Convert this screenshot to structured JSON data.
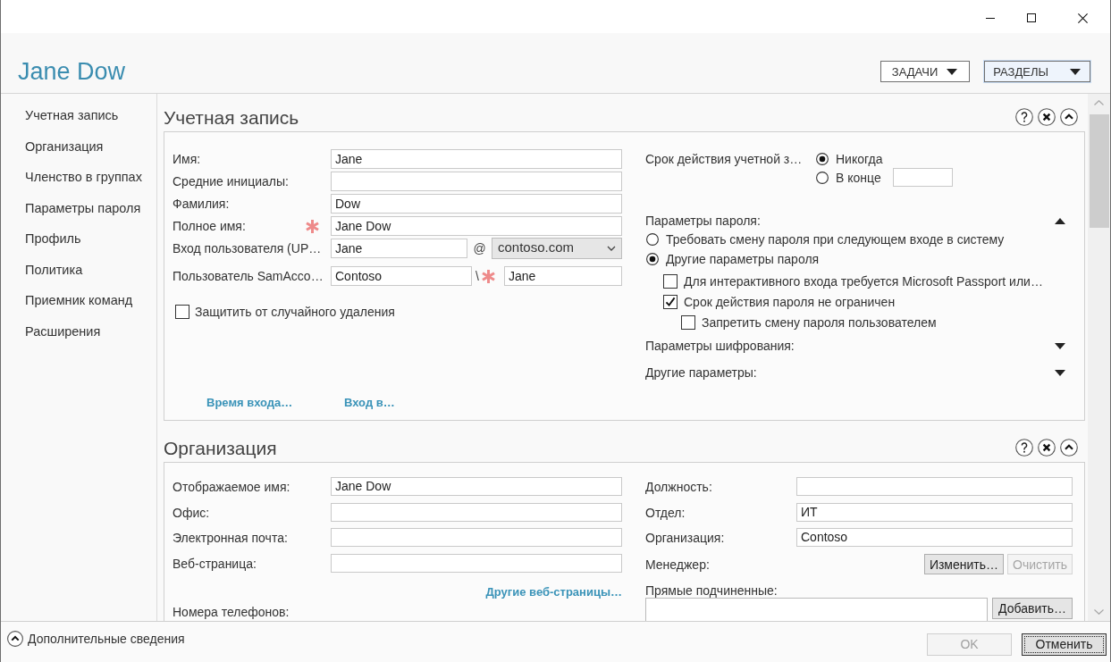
{
  "header": {
    "title": "Jane Dow",
    "menus": [
      {
        "label": "ЗАДАЧИ",
        "highlighted": false
      },
      {
        "label": "РАЗДЕЛЫ",
        "highlighted": true
      }
    ]
  },
  "sidebar": {
    "items": [
      {
        "label": "Учетная запись"
      },
      {
        "label": "Организация"
      },
      {
        "label": "Членство в группах"
      },
      {
        "label": "Параметры пароля"
      },
      {
        "label": "Профиль"
      },
      {
        "label": "Политика"
      },
      {
        "label": "Приемник команд"
      },
      {
        "label": "Расширения"
      }
    ]
  },
  "account": {
    "title": "Учетная запись",
    "fields": [
      {
        "kind": "text",
        "label": "Имя:",
        "value": "Jane",
        "required": false
      },
      {
        "kind": "text",
        "label": "Средние инициалы:",
        "required": false
      },
      {
        "kind": "text",
        "label": "Фамилия:",
        "value": "Dow",
        "required": false
      },
      {
        "kind": "text",
        "label": "Полное имя:",
        "value": "Jane Dow",
        "required": true
      },
      {
        "kind": "upn",
        "label": "Вход пользователя (UP…",
        "value": "Jane",
        "separator": "@",
        "domain": "contoso.com",
        "required": false
      },
      {
        "kind": "sam",
        "label": "Пользователь SamAcco…",
        "value": "Contoso",
        "separator": "\\",
        "value_2": "Jane",
        "required": true
      }
    ],
    "protect": {
      "label": "Защитить от случайного удаления",
      "checked": false
    },
    "links": [
      "Время входа…",
      "Вход в…"
    ],
    "expiry": {
      "label": "Срок действия учетной з…",
      "options": [
        {
          "kind": "plain",
          "label": "Никогда",
          "selected": true
        },
        {
          "kind": "date",
          "label": "В конце",
          "selected": false
        }
      ]
    },
    "password": {
      "label": "Параметры пароля:",
      "expanded": true,
      "options": [
        {
          "label": "Требовать смену пароля при следующем входе в систему",
          "selected": false
        },
        {
          "label": "Другие параметры пароля",
          "selected": true
        }
      ],
      "checkboxes": [
        {
          "label": "Для интерактивного входа требуется Microsoft Passport или…",
          "checked": false
        },
        {
          "label": "Срок действия пароля не ограничен",
          "checked": true,
          "children": [
            {
              "label": "Запретить смену пароля пользователем",
              "checked": false
            }
          ]
        }
      ]
    },
    "groups": [
      {
        "label": "Параметры шифрования:",
        "expanded": false
      },
      {
        "label": "Другие параметры:",
        "expanded": false
      }
    ]
  },
  "organization": {
    "title": "Организация",
    "fields": [
      {
        "label": "Отображаемое имя:",
        "value": "Jane Dow"
      },
      {
        "label": "Офис:"
      },
      {
        "label": "Электронная почта:"
      },
      {
        "label": "Веб-страница:"
      }
    ],
    "link": "Другие веб-страницы…",
    "phones_label": "Номера телефонов:",
    "details": [
      {
        "label": "Должность:"
      },
      {
        "label": "Отдел:",
        "value": "ИТ"
      },
      {
        "label": "Организация:",
        "value": "Contoso"
      }
    ],
    "manager": {
      "label": "Менеджер:",
      "buttons": [
        {
          "label": "Изменить…",
          "disabled": false
        },
        {
          "label": "Очистить",
          "disabled": true
        }
      ]
    },
    "reports": {
      "label": "Прямые подчиненные:",
      "button": "Добавить…"
    }
  },
  "footer": {
    "expander": "Дополнительные сведения",
    "buttons": [
      {
        "label": "OK",
        "disabled": true,
        "focused": false
      },
      {
        "label": "Отменить",
        "disabled": false,
        "focused": true
      }
    ]
  }
}
